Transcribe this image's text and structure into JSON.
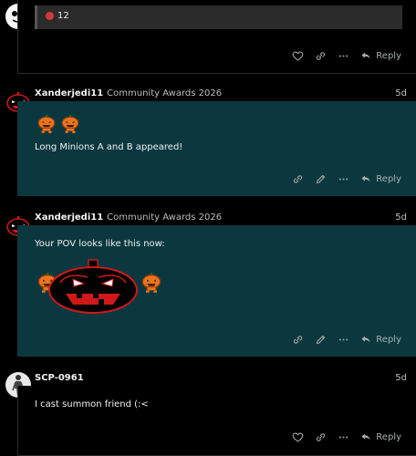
{
  "post1": {
    "quote_count": "12",
    "reply_label": "Reply"
  },
  "post2": {
    "username": "Xanderjedi11",
    "flair": "Community Awards 2026",
    "date": "5d",
    "body": "Long Minions A and B appeared!",
    "reply_label": "Reply"
  },
  "post3": {
    "username": "Xanderjedi11",
    "flair": "Community Awards 2026",
    "date": "5d",
    "body": "Your POV looks like this now:",
    "reply_label": "Reply"
  },
  "post4": {
    "username": "SCP-0961",
    "date": "5d",
    "body": "I cast summon friend (:<",
    "reply_label": "Reply"
  },
  "colors": {
    "teal_bg": "#0b383f",
    "pumpkin": "#e8761e",
    "pumpkin_dark": "#b14a10",
    "red_outline": "#d01818"
  },
  "icons": [
    "heart-icon",
    "link-icon",
    "more-icon",
    "reply-icon",
    "pencil-icon"
  ]
}
